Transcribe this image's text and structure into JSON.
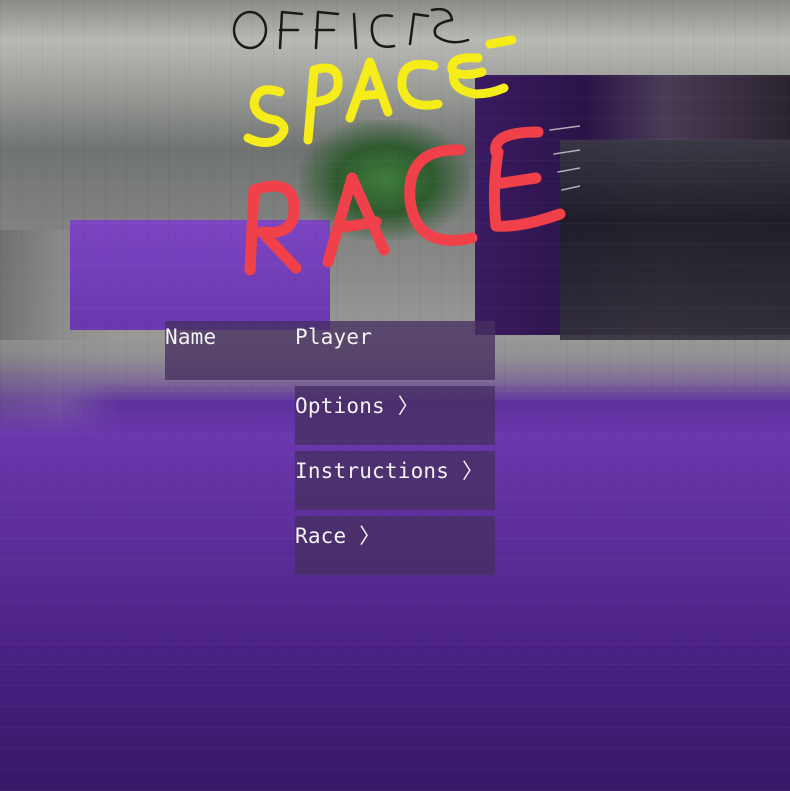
{
  "title": {
    "line1": "OFFICE",
    "line2": "SPACE",
    "line3": "RACE"
  },
  "menu": {
    "name_label": "Name",
    "name_value": "Player",
    "options_label": "Options 〉",
    "instructions_label": "Instructions 〉",
    "race_label": "Race 〉"
  },
  "colors": {
    "title_line1": "#1a1a1a",
    "title_line2": "#f5ec1a",
    "title_line3": "#f0404a",
    "menu_bg": "#46305f",
    "menu_text": "#f2f2f2",
    "floor": "#5a2c98"
  }
}
